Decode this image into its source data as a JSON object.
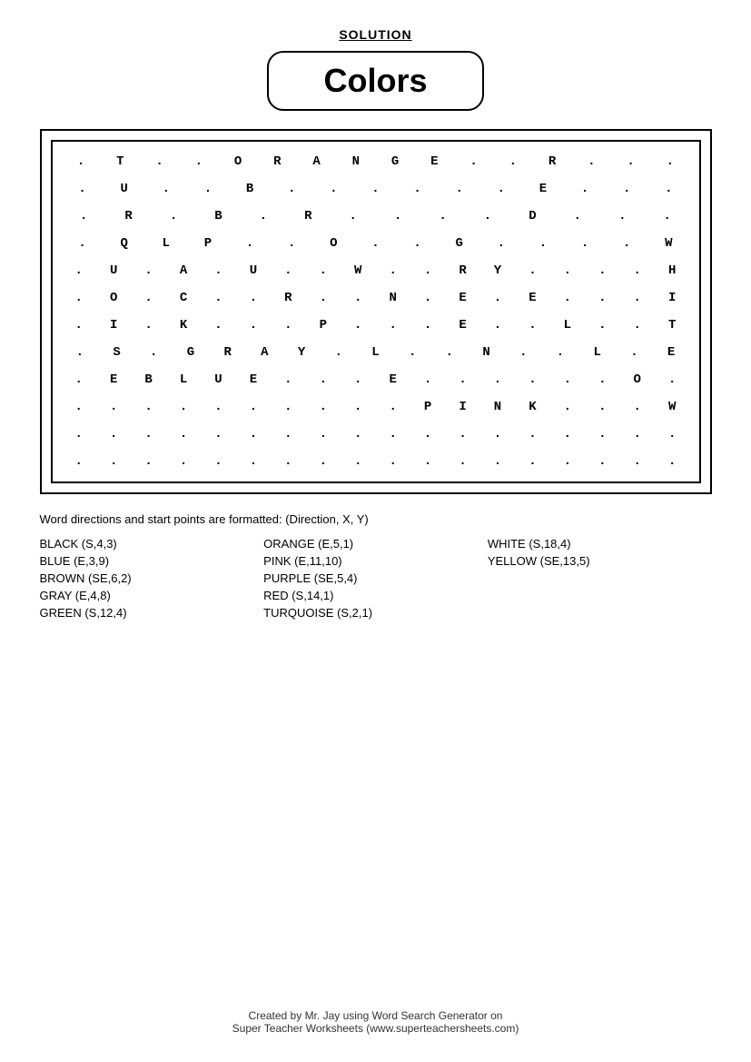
{
  "header": {
    "solution_label": "SOLUTION",
    "title": "Colors"
  },
  "grid": {
    "rows": [
      [
        ".",
        "T",
        ".",
        ".",
        "O",
        "R",
        "A",
        "N",
        "G",
        "E",
        ".",
        ".",
        "R",
        ".",
        ".",
        "."
      ],
      [
        ".",
        "U",
        ".",
        ".",
        "B",
        ".",
        ".",
        ".",
        ".",
        ".",
        ".",
        "E",
        ".",
        ".",
        "."
      ],
      [
        ".",
        "R",
        ".",
        "B",
        ".",
        "R",
        ".",
        ".",
        ".",
        ".",
        "D",
        ".",
        ".",
        "."
      ],
      [
        ".",
        "Q",
        "L",
        "P",
        ".",
        ".",
        "O",
        ".",
        ".",
        "G",
        ".",
        ".",
        ".",
        ".",
        "W"
      ],
      [
        ".",
        "U",
        ".",
        "A",
        ".",
        "U",
        ".",
        ".",
        "W",
        ".",
        ".",
        "R",
        "Y",
        ".",
        ".",
        ".",
        ".",
        "H"
      ],
      [
        ".",
        "O",
        ".",
        "C",
        ".",
        ".",
        "R",
        ".",
        ".",
        "N",
        ".",
        "E",
        ".",
        "E",
        ".",
        ".",
        ".",
        "I"
      ],
      [
        ".",
        "I",
        ".",
        "K",
        ".",
        ".",
        ".",
        "P",
        ".",
        ".",
        ".",
        "E",
        ".",
        ".",
        "L",
        ".",
        ".",
        "T"
      ],
      [
        ".",
        "S",
        ".",
        "G",
        "R",
        "A",
        "Y",
        ".",
        "L",
        ".",
        ".",
        "N",
        ".",
        ".",
        "L",
        ".",
        "E"
      ],
      [
        ".",
        "E",
        "B",
        "L",
        "U",
        "E",
        ".",
        ".",
        ".",
        "E",
        ".",
        ".",
        ".",
        ".",
        ".",
        ".",
        "O",
        "."
      ],
      [
        ".",
        ".",
        ".",
        ".",
        ".",
        ".",
        ".",
        ".",
        ".",
        ".",
        "P",
        "I",
        "N",
        "K",
        ".",
        ".",
        ".",
        "W"
      ],
      [
        ".",
        ".",
        ".",
        ".",
        ".",
        ".",
        ".",
        ".",
        ".",
        ".",
        ".",
        ".",
        ".",
        ".",
        ".",
        ".",
        ".",
        "."
      ],
      [
        ".",
        ".",
        ".",
        ".",
        ".",
        ".",
        ".",
        ".",
        ".",
        ".",
        ".",
        ".",
        ".",
        ".",
        ".",
        ".",
        ".",
        "."
      ]
    ]
  },
  "directions": {
    "format_note": "Word directions and start points are formatted: (Direction, X, Y)",
    "columns": [
      [
        "BLACK (S,4,3)",
        "BLUE (E,3,9)",
        "BROWN (SE,6,2)",
        "GRAY (E,4,8)",
        "GREEN (S,12,4)"
      ],
      [
        "ORANGE (E,5,1)",
        "PINK (E,11,10)",
        "PURPLE (SE,5,4)",
        "RED (S,14,1)",
        "TURQUOISE (S,2,1)"
      ],
      [
        "WHITE (S,18,4)",
        "YELLOW (SE,13,5)"
      ]
    ]
  },
  "footer": {
    "line1": "Created by Mr. Jay using Word Search Generator on",
    "line2": "Super Teacher Worksheets (www.superteachersheets.com)"
  }
}
